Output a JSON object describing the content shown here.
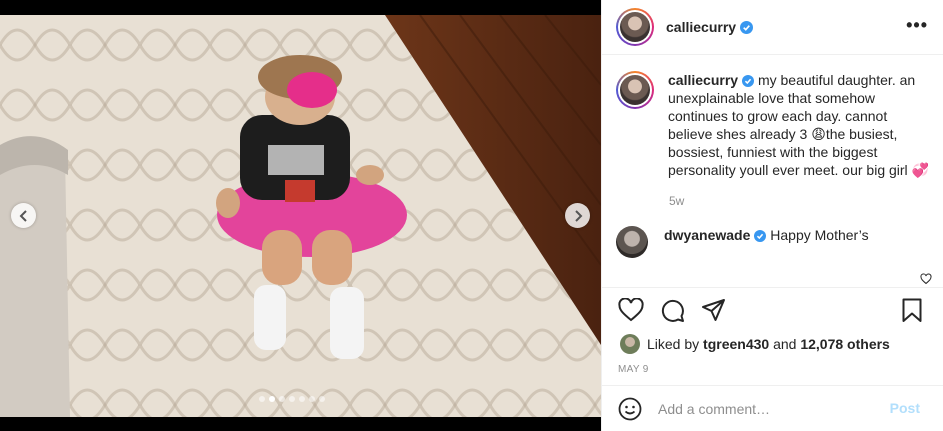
{
  "header": {
    "username": "calliecurry",
    "more_label": "•••"
  },
  "caption": {
    "username": "calliecurry",
    "text_1": "my beautiful daughter. an unexplainable love that somehow continues to grow each day. cannot believe shes already 3 ",
    "emoji_1": "😩",
    "text_2": "the busiest, bossiest, funniest with the biggest personality youll ever meet. our big girl ",
    "emoji_2": "💞",
    "time": "5w"
  },
  "comments": [
    {
      "username": "dwyanewade",
      "text": "Happy Mother’s"
    }
  ],
  "likes": {
    "prefix": "Liked by ",
    "liker": "tgreen430",
    "mid": " and ",
    "others": "12,078 others"
  },
  "date": "MAY 9",
  "add_comment": {
    "placeholder": "Add a comment…",
    "post_label": "Post"
  },
  "carousel": {
    "slide_count": 7,
    "active_index": 1
  },
  "colors": {
    "verified": "#3897f0",
    "post_button": "#b2dffc",
    "muted": "#8e8e8e"
  }
}
